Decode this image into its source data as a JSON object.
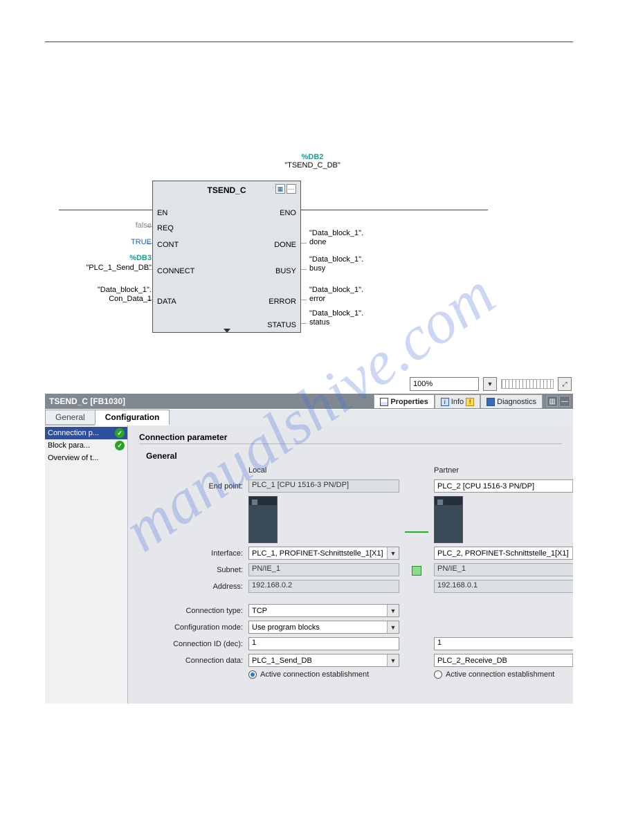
{
  "db": {
    "id": "%DB2",
    "name": "\"TSEND_C_DB\""
  },
  "block": {
    "title": "TSEND_C",
    "leftPins": [
      "EN",
      "REQ",
      "CONT",
      "CONNECT",
      "DATA"
    ],
    "rightPins": [
      "ENO",
      "DONE",
      "BUSY",
      "ERROR",
      "STATUS"
    ]
  },
  "leftConn": {
    "req": "false",
    "cont": "TRUE",
    "connectSym": "%DB3",
    "connect": "\"PLC_1_Send_DB\"",
    "data1": "\"Data_block_1\".",
    "data2": "Con_Data_1"
  },
  "rightConn": {
    "done1": "\"Data_block_1\".",
    "done2": "done",
    "busy1": "\"Data_block_1\".",
    "busy2": "busy",
    "error1": "\"Data_block_1\".",
    "error2": "error",
    "status1": "\"Data_block_1\".",
    "status2": "status"
  },
  "zoom": "100%",
  "panelTitle": "TSEND_C [FB1030]",
  "headerTabs": {
    "properties": "Properties",
    "info": "Info",
    "diagnostics": "Diagnostics"
  },
  "topTabs": {
    "general": "General",
    "configuration": "Configuration"
  },
  "nav": {
    "connParam": "Connection p...",
    "blockParam": "Block para...",
    "overview": "Overview of t..."
  },
  "section": {
    "title": "Connection parameter",
    "sub": "General"
  },
  "cols": {
    "local": "Local",
    "partner": "Partner"
  },
  "labels": {
    "endpoint": "End point:",
    "interface": "Interface:",
    "subnet": "Subnet:",
    "address": "Address:",
    "conntype": "Connection type:",
    "confmode": "Configuration mode:",
    "connid": "Connection ID (dec):",
    "conndata": "Connection data:"
  },
  "local": {
    "endpoint": "PLC_1 [CPU 1516-3 PN/DP]",
    "interface": "PLC_1, PROFINET-Schnittstelle_1[X1]",
    "subnet": "PN/IE_1",
    "address": "192.168.0.2",
    "conntype": "TCP",
    "confmode": "Use program blocks",
    "connid": "1",
    "conndata": "PLC_1_Send_DB",
    "radio": "Active connection establishment"
  },
  "partner": {
    "endpoint": "PLC_2 [CPU 1516-3 PN/DP]",
    "interface": "PLC_2, PROFINET-Schnittstelle_1[X1]",
    "subnet": "PN/IE_1",
    "address": "192.168.0.1",
    "connid": "1",
    "conndata": "PLC_2_Receive_DB",
    "radio": "Active connection establishment"
  },
  "watermark": "manualshive.com"
}
